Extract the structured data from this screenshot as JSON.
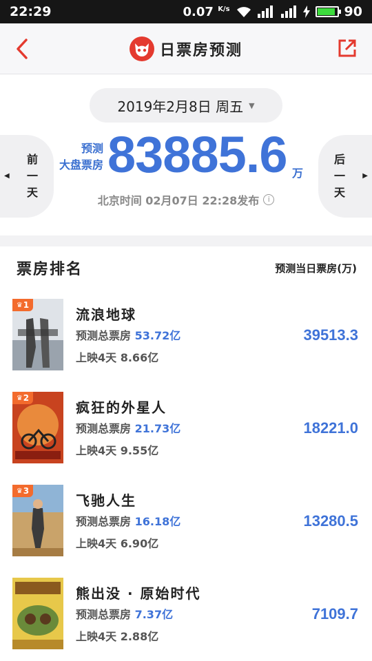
{
  "status_bar": {
    "time": "22:29",
    "net_speed": "0.07",
    "net_unit": "K/s",
    "battery": "90",
    "battery_level": 0.9
  },
  "header": {
    "title": "日票房预测"
  },
  "summary": {
    "date": "2019年2月8日 周五",
    "prev_day": [
      "前",
      "一",
      "天"
    ],
    "next_day": [
      "后",
      "一",
      "天"
    ],
    "predict_label_1": "预测",
    "predict_label_2": "大盘票房",
    "total": "83885.6",
    "unit": "万",
    "release_info": "北京时间 02月07日 22:28发布",
    "info_icon": "i"
  },
  "ranking": {
    "title": "票房排名",
    "column_label": "预测当日票房(万)",
    "total_label": "预测总票房",
    "movies": [
      {
        "rank": "1",
        "name": "流浪地球",
        "total": "53.72亿",
        "days": "上映4天",
        "gross": "8.66亿",
        "value": "39513.3"
      },
      {
        "rank": "2",
        "name": "疯狂的外星人",
        "total": "21.73亿",
        "days": "上映4天",
        "gross": "9.55亿",
        "value": "18221.0"
      },
      {
        "rank": "3",
        "name": "飞驰人生",
        "total": "16.18亿",
        "days": "上映4天",
        "gross": "6.90亿",
        "value": "13280.5"
      },
      {
        "rank": "",
        "name": "熊出没 · 原始时代",
        "total": "7.37亿",
        "days": "上映4天",
        "gross": "2.88亿",
        "value": "7109.7"
      }
    ]
  },
  "colors": {
    "accent_blue": "#3f73d8",
    "brand_red": "#e43a2f",
    "badge_orange": "#f36b2d"
  },
  "icons": [
    "back-arrow-icon",
    "share-icon",
    "cat-logo-icon",
    "wifi-icon",
    "signal-icon",
    "bolt-icon",
    "battery-icon",
    "caret-down-icon",
    "info-icon",
    "crown-icon"
  ]
}
